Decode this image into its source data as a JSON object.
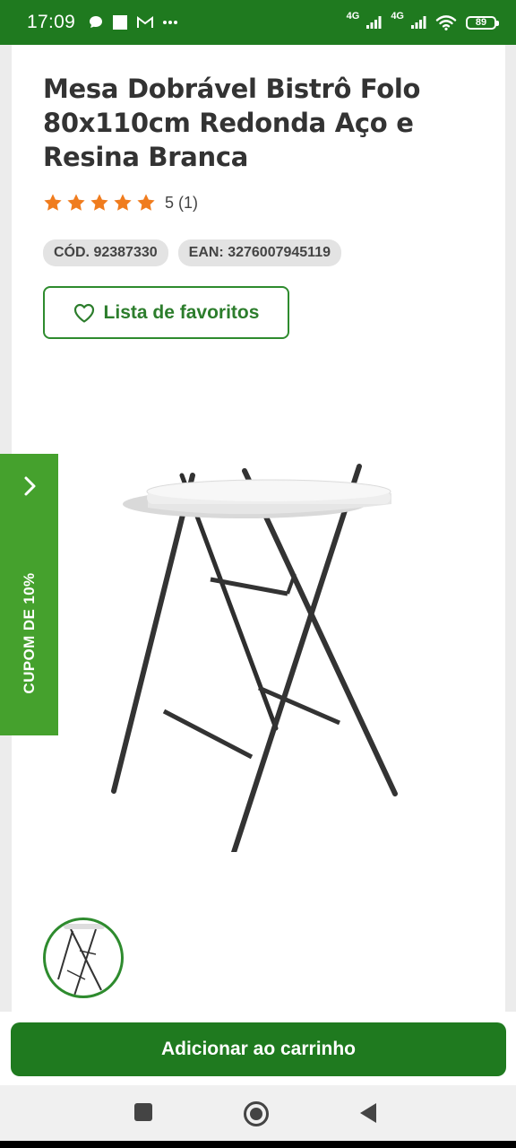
{
  "status_bar": {
    "time": "17:09",
    "network_1": "4G",
    "network_2": "4G",
    "battery": "89",
    "icons": [
      "chat-bubble-icon",
      "square-notification-icon",
      "gmail-icon",
      "more-dots-icon",
      "signal-icon",
      "signal-icon",
      "wifi-icon",
      "battery-icon"
    ]
  },
  "product": {
    "title": "Mesa Dobrável Bistrô Folo 80x110cm Redonda Aço e Resina Branca",
    "rating_value": 5,
    "rating_text": "5 (1)",
    "code_tag": "CÓD. 92387330",
    "ean_tag": "EAN: 3276007945119",
    "favorites_label": "Lista de favoritos"
  },
  "coupon": {
    "label": "CUPOM DE 10%"
  },
  "cart": {
    "add_label": "Adicionar ao carrinho"
  },
  "colors": {
    "brand_green": "#1f7a1f",
    "coupon_green": "#45a12d",
    "star_orange": "#f07c1e"
  }
}
